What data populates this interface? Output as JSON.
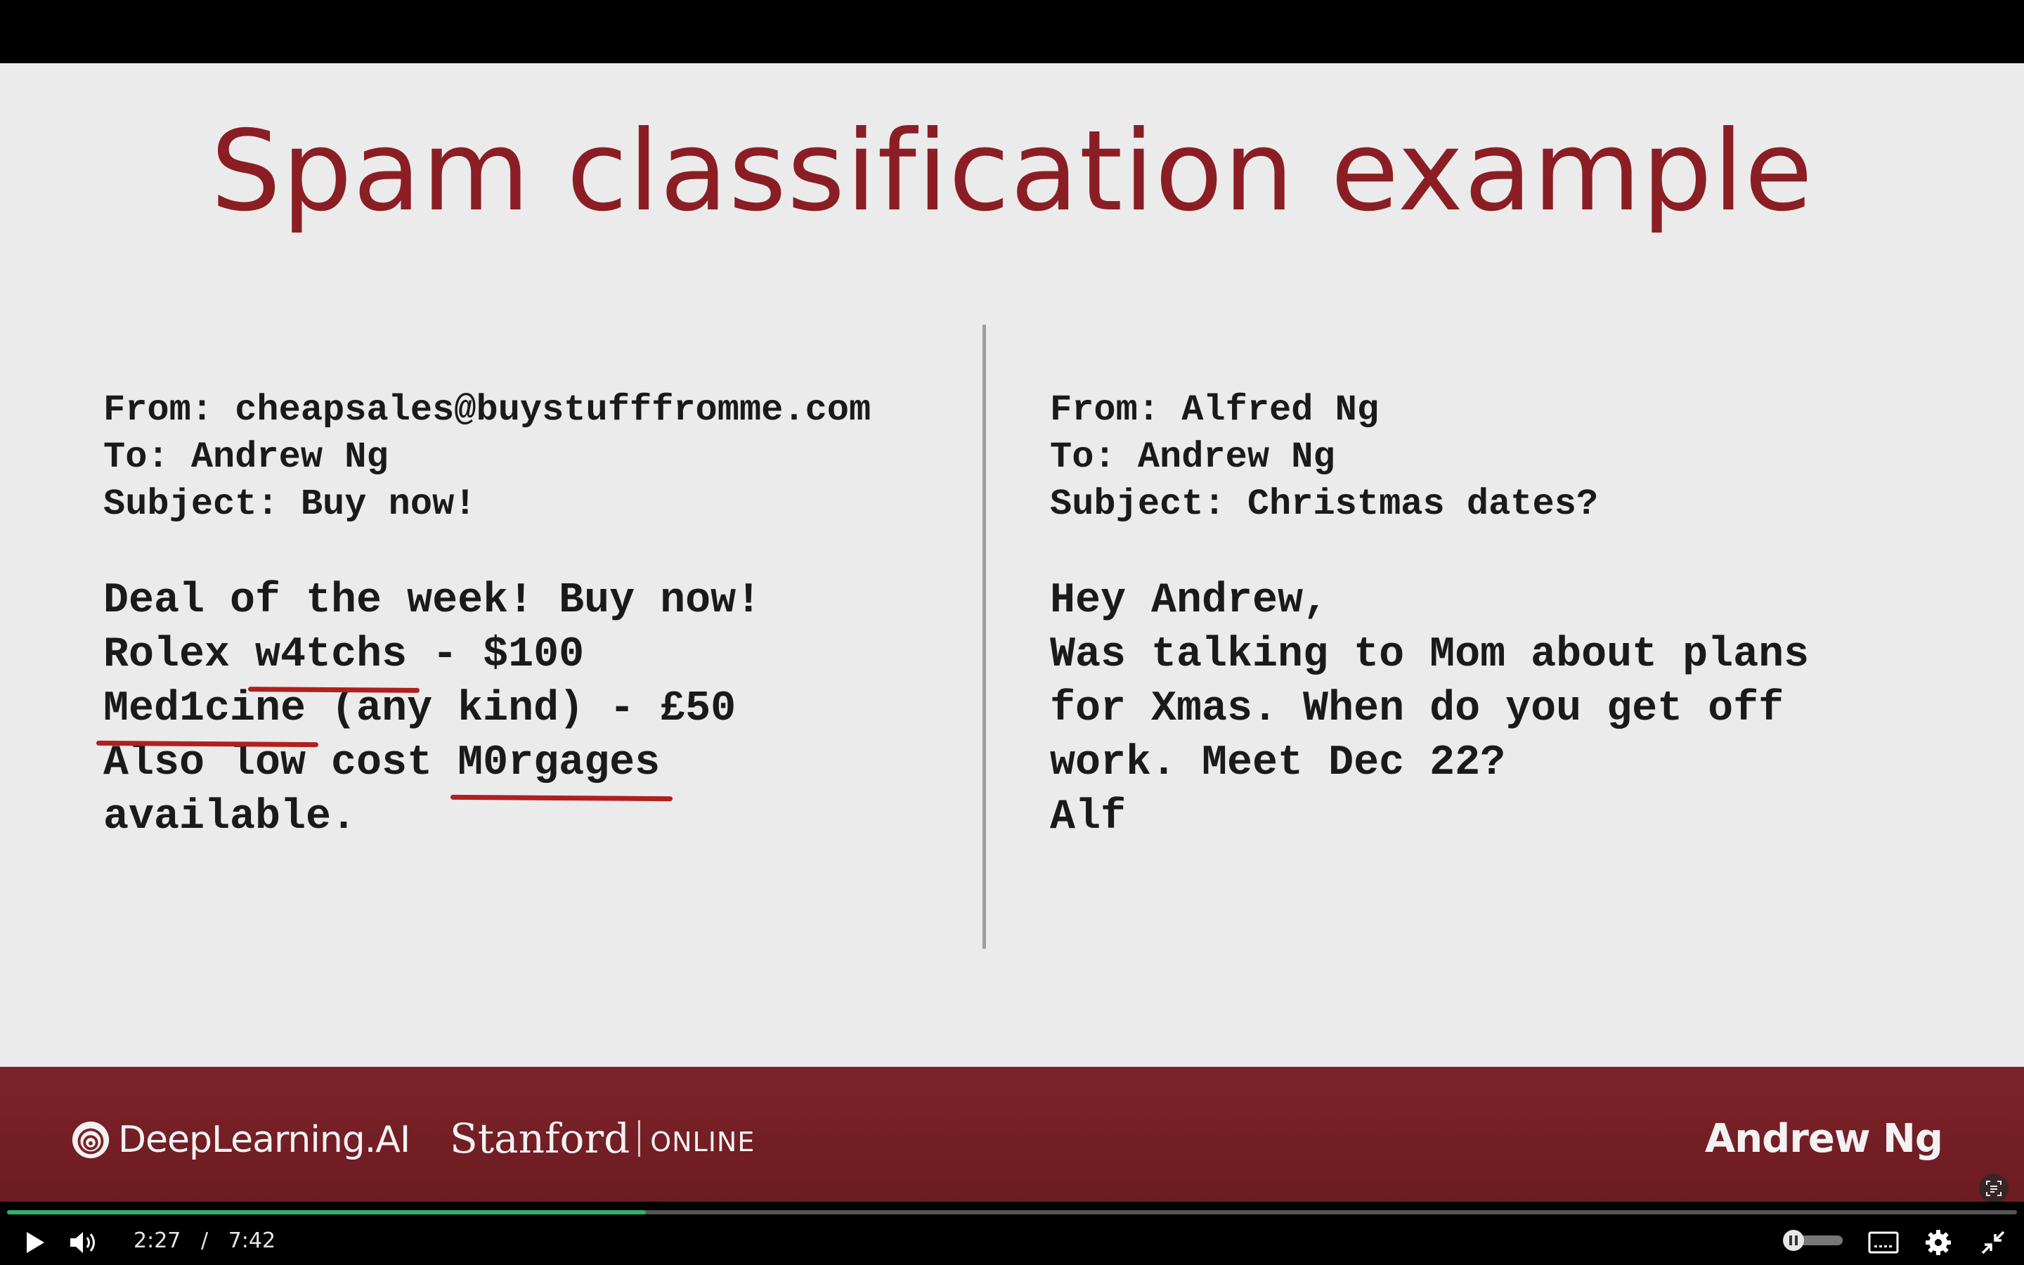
{
  "slide": {
    "title": "Spam classification example",
    "left_email": {
      "headers": [
        "From: cheapsales@buystufffromme.com",
        "To: Andrew Ng",
        "Subject: Buy now!"
      ],
      "body": {
        "line1": "Deal of the week! Buy now!",
        "line2_a": "Rolex ",
        "line2_ul": "w4tchs",
        "line2_b": " - $100",
        "line3_ul": "Med1cine",
        "line3_b": " (any kind) - £50",
        "line4_a": "Also low cost ",
        "line4_ul": "M0rgages",
        "line5": "available."
      }
    },
    "right_email": {
      "headers": [
        "From: Alfred Ng",
        "To: Andrew Ng",
        "Subject: Christmas dates?"
      ],
      "body": [
        "Hey Andrew,",
        "Was talking to Mom about plans",
        "for Xmas. When do you get off",
        "work. Meet Dec 22?",
        "Alf"
      ]
    },
    "underline_color": "#b0201f",
    "title_color": "#8b1e24"
  },
  "footer": {
    "brand_dl": "DeepLearning.AI",
    "brand_stanford": "Stanford",
    "brand_online": "ONLINE",
    "presenter": "Andrew Ng",
    "background": "#7b2128"
  },
  "player": {
    "current_time": "2:27",
    "separator": "/",
    "duration": "7:42",
    "progress_fraction": 0.318,
    "icons": [
      "play-icon",
      "volume-icon",
      "autoplay-toggle",
      "captions-icon",
      "settings-gear-icon",
      "exit-fullscreen-icon",
      "caption-overlay-icon"
    ],
    "progress_color": "#2fb36b"
  }
}
